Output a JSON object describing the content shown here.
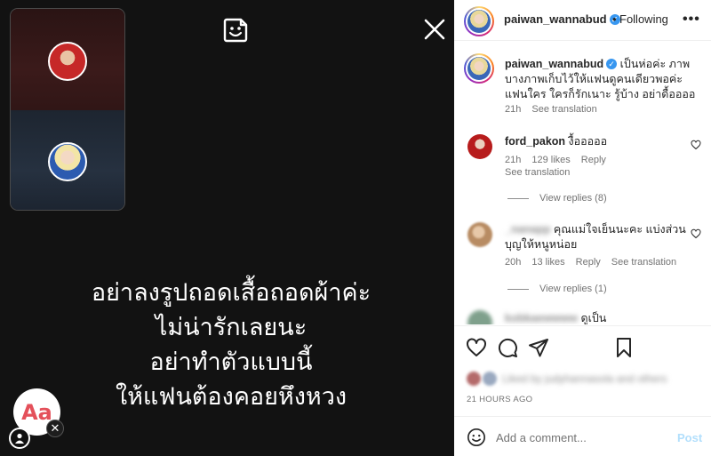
{
  "story": {
    "text_lines": [
      "อย่าลงรูปถอดเสื้อถอดผ้าค่ะ",
      "ไม่น่ารักเลยนะ",
      "อย่าทำตัวแบบนี้",
      "ให้แฟนต้องคอยหึงหวง"
    ],
    "text_tool_label": "Aa"
  },
  "header": {
    "username": "paiwan_wannabud",
    "separator": "•",
    "follow_label": "Following",
    "more_label": "•••"
  },
  "caption": {
    "username": "paiwan_wannabud",
    "text": "เป็นห่อค่ะ ภาพบางภาพเก็บไว้ให้แฟนดูคนเดียวพอค่ะ แฟนใคร ใครก็รักเนาะ รู้บ้าง อย่าดื้ออออ",
    "time": "21h",
    "see_translation": "See translation"
  },
  "comments": [
    {
      "username": "ford_pakon",
      "text": "งื้อออออ",
      "time": "21h",
      "likes": "129 likes",
      "reply": "Reply",
      "see_translation": "See translation",
      "view_replies": "View replies (8)"
    },
    {
      "username": "_nanapp",
      "text": "คุณแม่ใจเย็นนะคะ แบ่งส่วนบุญให้หนูหน่อย",
      "time": "20h",
      "likes": "13 likes",
      "reply": "Reply",
      "see_translation": "See translation",
      "view_replies": "View replies (1)"
    },
    {
      "username": "kobkaewwww",
      "text": "ดูเป็น"
    }
  ],
  "likes_line": "Liked by judyhannasola and others",
  "timestamp": "21 HOURS AGO",
  "add_comment": {
    "placeholder": "Add a comment...",
    "post_label": "Post"
  },
  "colors": {
    "verified": "#3897f0",
    "post_button": "#b2dffc",
    "story_bg": "#121212"
  }
}
